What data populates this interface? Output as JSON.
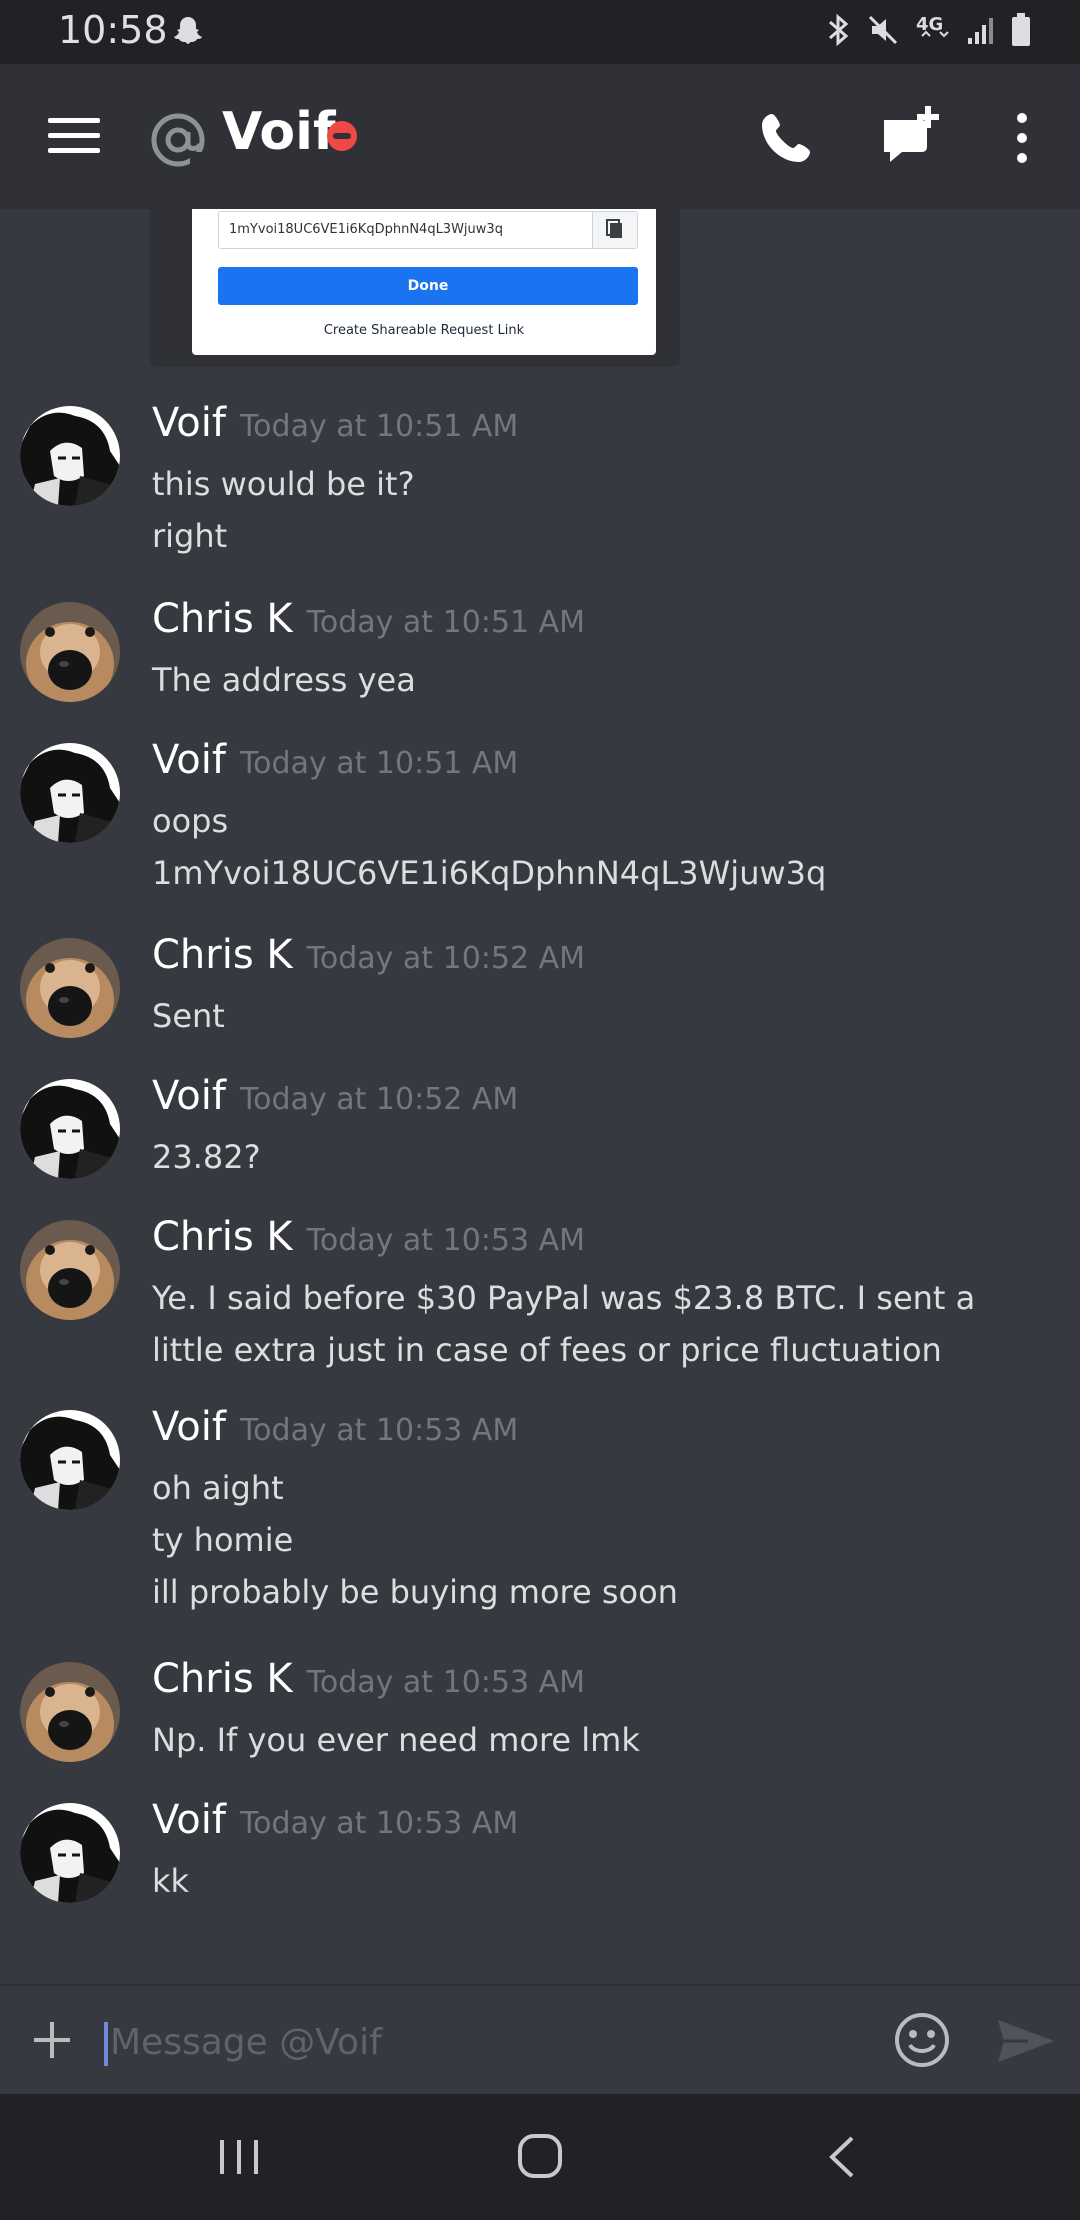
{
  "status_bar": {
    "time": "10:58",
    "network": "4G"
  },
  "header": {
    "title": "Voif"
  },
  "embed": {
    "address": "1mYvoi18UC6VE1i6KqDphnN4qL3Wjuw3q",
    "done_label": "Done",
    "link_label": "Create Shareable Request Link"
  },
  "messages": [
    {
      "author": "Voif",
      "time": "Today at 10:51 AM",
      "lines": [
        "this would be it?",
        "right"
      ]
    },
    {
      "author": "Chris K",
      "time": "Today at 10:51 AM",
      "lines": [
        "The address yea"
      ]
    },
    {
      "author": "Voif",
      "time": "Today at 10:51 AM",
      "lines": [
        "oops",
        "1mYvoi18UC6VE1i6KqDphnN4qL3Wjuw3q"
      ]
    },
    {
      "author": "Chris K",
      "time": "Today at 10:52 AM",
      "lines": [
        "Sent"
      ]
    },
    {
      "author": "Voif",
      "time": "Today at 10:52 AM",
      "lines": [
        "23.82?"
      ]
    },
    {
      "author": "Chris K",
      "time": "Today at 10:53 AM",
      "lines": [
        "Ye. I said before $30 PayPal was $23.8 BTC. I sent a little extra just in case of fees or price fluctuation"
      ]
    },
    {
      "author": "Voif",
      "time": "Today at 10:53 AM",
      "lines": [
        "oh aight",
        "ty homie",
        "ill probably be buying more soon"
      ]
    },
    {
      "author": "Chris K",
      "time": "Today at 10:53 AM",
      "lines": [
        "Np. If you ever need more lmk"
      ]
    },
    {
      "author": "Voif",
      "time": "Today at 10:53 AM",
      "lines": [
        "kk"
      ]
    }
  ],
  "composer": {
    "placeholder": "Message @Voif",
    "value": ""
  },
  "colors": {
    "background": "#36393f",
    "header": "#2f3136",
    "system_bar": "#202225",
    "dnd_red": "#f04747",
    "blurple": "#7289da",
    "timestamp": "#72767d"
  }
}
